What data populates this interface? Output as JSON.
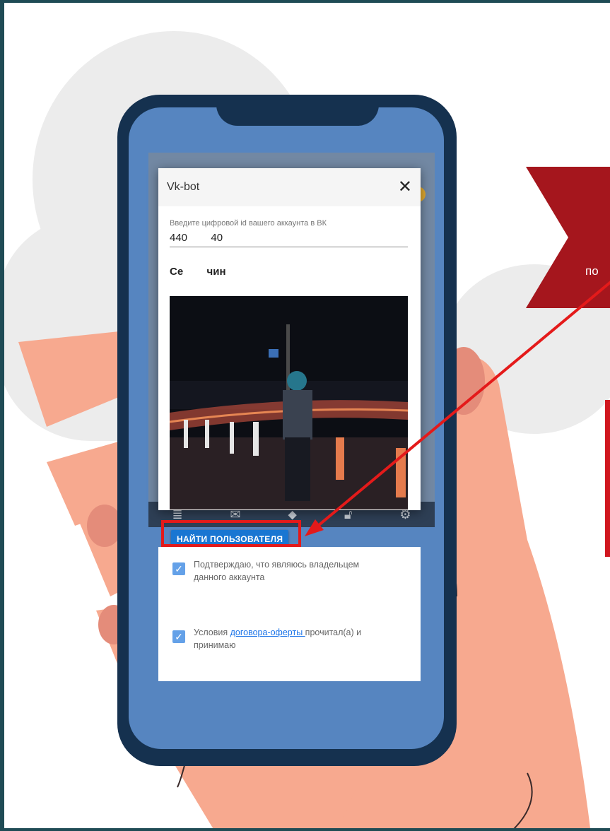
{
  "dialog": {
    "title": "Vk-bot",
    "close_glyph": "✕",
    "field_label": "Введите цифровой id вашего аккаунта в ВК",
    "field_value": "440        40",
    "username": "Се        чин"
  },
  "find_button": {
    "label": "НАЙТИ ПОЛЬЗОВАТЕЛЯ"
  },
  "checks": [
    {
      "text": "Подтверждаю, что являюсь владельцем данного аккаунта"
    },
    {
      "text_before": "Условия ",
      "link_text": "договора-оферты ",
      "text_after": "прочитал(а) и принимаю"
    }
  ],
  "bottom_nav": [
    {
      "icon": "list-icon"
    },
    {
      "icon": "mail-icon"
    },
    {
      "icon": "tag-icon"
    },
    {
      "icon": "lock-icon"
    },
    {
      "icon": "gear-icon"
    }
  ],
  "banner": {
    "text": "по"
  },
  "colors": {
    "frame": "#1f4b55",
    "phone": "#15314f",
    "screen": "#5685c0",
    "button": "#1976d2",
    "accent_red": "#e41a1a",
    "banner_red": "#a5161d",
    "hand": "#f7a98f"
  }
}
